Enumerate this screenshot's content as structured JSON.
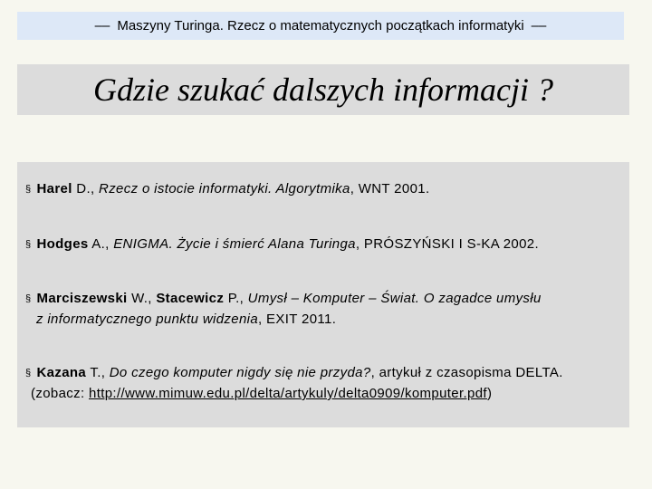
{
  "header": {
    "title": "Maszyny Turinga. Rzecz o matematycznych początkach informatyki",
    "dash_left": "––",
    "dash_right": "––"
  },
  "slide": {
    "title": "Gdzie szukać dalszych informacji ?"
  },
  "references": [
    {
      "bullet": "§",
      "author1": "Harel",
      "author1_rest": " D., ",
      "title": "Rzecz o istocie informatyki. Algorytmika",
      "rest": ", WNT 2001."
    },
    {
      "bullet": "§",
      "author1": "Hodges",
      "author1_rest": " A., ",
      "title": "ENIGMA. Życie i śmierć Alana Turinga",
      "rest": ", PRÓSZYŃSKI I S-KA 2002."
    },
    {
      "bullet": "§",
      "author1": "Marciszewski",
      "author1_rest": " W., ",
      "author2": "Stacewicz",
      "author2_rest": " P., ",
      "title_line1": "Umysł – Komputer – Świat. O zagadce umysłu",
      "title_line2": "z informatycznego punktu widzenia",
      "rest": ", EXIT 2011."
    },
    {
      "bullet": "§",
      "author1": "Kazana",
      "author1_rest": " T., ",
      "title": "Do czego komputer nigdy się nie przyda?",
      "rest": ", artykuł z czasopisma DELTA.",
      "see_prefix": "(zobacz: ",
      "link": "http://www.mimuw.edu.pl/delta/artykuly/delta0909/komputer.pdf",
      "see_suffix": ")"
    }
  ]
}
